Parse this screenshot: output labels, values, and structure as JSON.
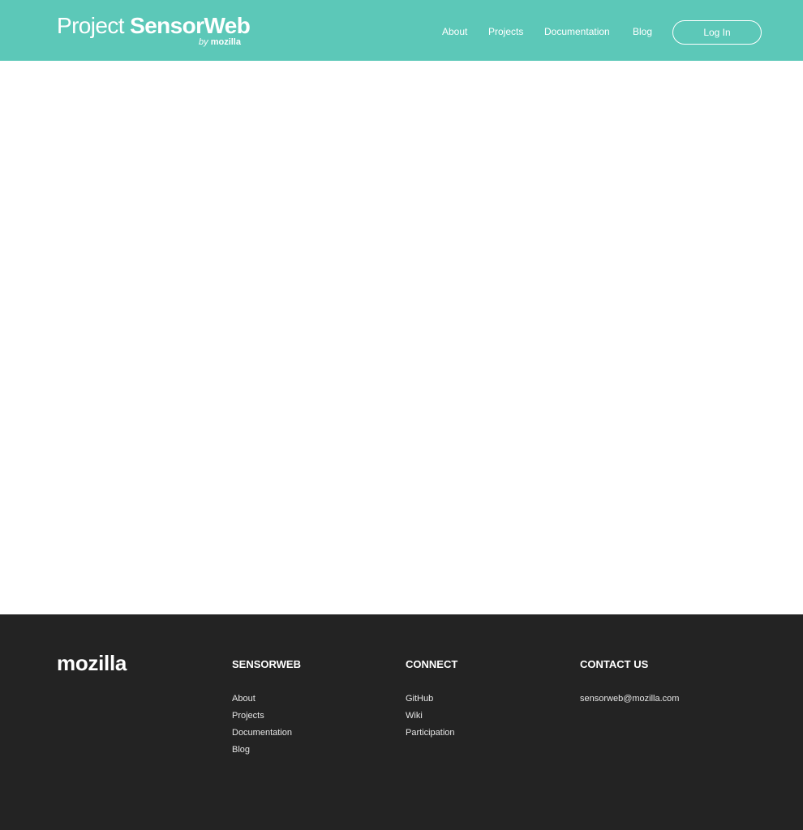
{
  "header": {
    "logo": {
      "word_light": "Project ",
      "word_bold": "SensorWeb",
      "by": "by ",
      "brand": "mozilla"
    },
    "nav": [
      {
        "label": "About"
      },
      {
        "label": "Projects"
      },
      {
        "label": "Documentation"
      },
      {
        "label": "Blog"
      }
    ],
    "login_label": "Log In"
  },
  "footer": {
    "logo": "mozilla",
    "columns": [
      {
        "heading": "SENSORWEB",
        "links": [
          {
            "label": "About"
          },
          {
            "label": "Projects"
          },
          {
            "label": "Documentation"
          },
          {
            "label": "Blog"
          }
        ]
      },
      {
        "heading": "CONNECT",
        "links": [
          {
            "label": "GitHub"
          },
          {
            "label": "Wiki"
          },
          {
            "label": "Participation"
          }
        ]
      },
      {
        "heading": "CONTACT US",
        "links": [
          {
            "label": "sensorweb@mozilla.com"
          }
        ]
      }
    ]
  },
  "colors": {
    "header_bg": "#5cc8b8",
    "footer_bg": "#232323",
    "text_light": "#ffffff"
  }
}
